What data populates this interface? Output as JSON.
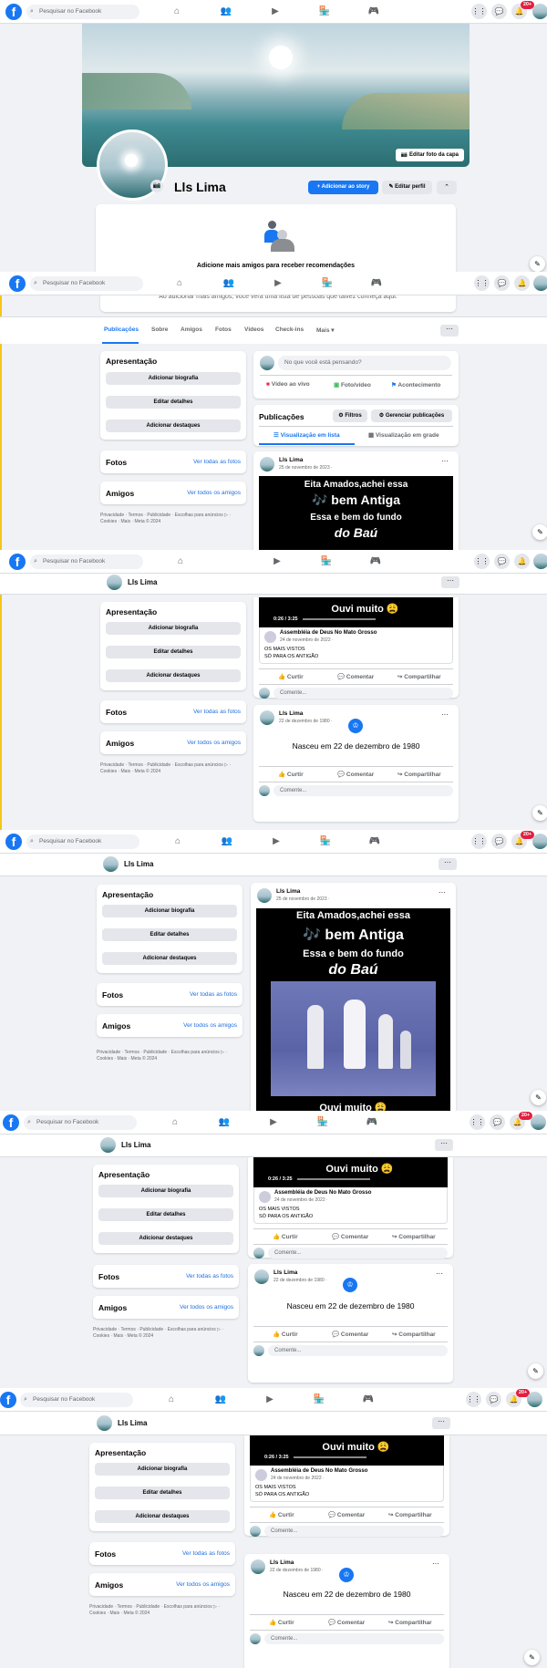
{
  "topbar": {
    "logo": "f",
    "search_placeholder": "Pesquisar no Facebook",
    "notif_badge": "20+",
    "nav_icons": [
      "home-icon",
      "friends-icon",
      "watch-icon",
      "marketplace-icon",
      "gaming-icon"
    ],
    "right_icons": [
      "menu-grid-icon",
      "messenger-icon",
      "bell-icon"
    ]
  },
  "profile": {
    "name": "Lls Lima",
    "edit_cover": "Editar foto da capa",
    "add_story": "Adicionar ao story",
    "edit_profile": "Editar perfil",
    "suggest_title": "Adicione mais amigos para receber recomendações",
    "suggest_text": "Ao adicionar mais amigos, você verá uma lista de pessoas que talvez conheça aqui."
  },
  "tabs": [
    "Publicações",
    "Sobre",
    "Amigos",
    "Fotos",
    "Vídeos",
    "Check-ins",
    "Mais ▾"
  ],
  "intro": {
    "title": "Apresentação",
    "buttons": [
      "Adicionar biografia",
      "Editar detalhes",
      "Adicionar destaques"
    ]
  },
  "photos": {
    "title": "Fotos",
    "link": "Ver todas as fotos"
  },
  "friends": {
    "title": "Amigos",
    "link": "Ver todos os amigos"
  },
  "footer": "Privacidade · Termos · Publicidade · Escolhas para anúncios ▷ · Cookies · Mais · Meta © 2024",
  "composer": {
    "placeholder": "No que você está pensando?",
    "actions": [
      "Vídeo ao vivo",
      "Foto/vídeo",
      "Acontecimento"
    ]
  },
  "posts_header": {
    "title": "Publicações",
    "filters": "Filtros",
    "manage": "Gerenciar publicações",
    "view_list": "Visualização em lista",
    "view_grid": "Visualização em grade"
  },
  "post1": {
    "author": "Lls Lima",
    "date": "25 de novembro de 2023 · ",
    "video_lines": [
      "Eita Amados,achei essa",
      "🎶 bem Antiga",
      "Essa e bem do fundo",
      "do Baú"
    ],
    "video_bottom": "Ouvi muito 😩",
    "time": "0:26 / 3:25",
    "shared_author": "Assembléia de Deus No Mato Grosso",
    "shared_date": "24 de novembro de 2022 · ",
    "shared_text": [
      "OS MAIS VISTOS",
      "SÓ PARA OS ANTIGÃO"
    ]
  },
  "post2": {
    "author": "Lls Lima",
    "date": "22 de dezembro de 1980 · ",
    "event": "Nasceu em 22 de dezembro de 1980"
  },
  "actions": {
    "like": "Curtir",
    "comment": "Comentar",
    "share": "Compartilhar",
    "comment_placeholder": "Comente..."
  },
  "colors": {
    "brand": "#1877f2",
    "badge": "#e41e3f",
    "link": "#216fdb",
    "bg": "#f0f2f5"
  }
}
